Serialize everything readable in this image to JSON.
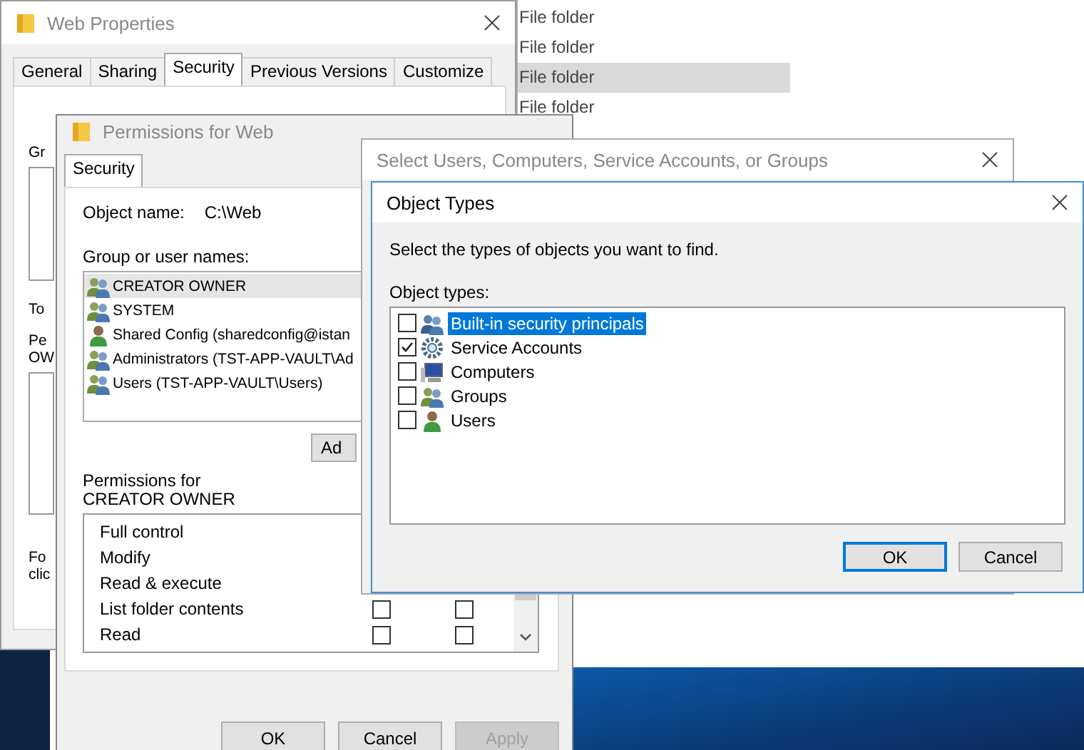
{
  "explorer": {
    "rows": [
      {
        "type": "File folder",
        "selected": false
      },
      {
        "type": "File folder",
        "selected": false
      },
      {
        "type": "File folder",
        "selected": true
      },
      {
        "type": "File folder",
        "selected": false
      }
    ]
  },
  "web_properties": {
    "title": "Web Properties",
    "tabs": [
      {
        "label": "General",
        "selected": false
      },
      {
        "label": "Sharing",
        "selected": false
      },
      {
        "label": "Security",
        "selected": true
      },
      {
        "label": "Previous Versions",
        "selected": false
      },
      {
        "label": "Customize",
        "selected": false
      }
    ],
    "visible_text": [
      "Gr",
      "To",
      "Pe",
      "OW",
      "Fo",
      "clic"
    ]
  },
  "permissions": {
    "title": "Permissions for Web",
    "tabs": [
      {
        "label": "Security",
        "selected": true
      }
    ],
    "object_name_label": "Object name:",
    "object_name": "C:\\Web",
    "group_label": "Group or user names:",
    "users": [
      {
        "name": "CREATOR OWNER",
        "kind": "group",
        "selected": true
      },
      {
        "name": "SYSTEM",
        "kind": "group",
        "selected": false
      },
      {
        "name": "Shared Config (sharedconfig@istan",
        "kind": "user",
        "selected": false
      },
      {
        "name": "Administrators (TST-APP-VAULT\\Ad",
        "kind": "group",
        "selected": false
      },
      {
        "name": "Users (TST-APP-VAULT\\Users)",
        "kind": "group",
        "selected": false
      }
    ],
    "add_button": "Ad",
    "permissions_label": "Permissions for CREATOR OWNER",
    "permissions": [
      {
        "name": "Full control"
      },
      {
        "name": "Modify"
      },
      {
        "name": "Read & execute"
      },
      {
        "name": "List folder contents",
        "allow": false,
        "deny": false
      },
      {
        "name": "Read",
        "allow": false,
        "deny": false
      }
    ],
    "buttons": [
      {
        "label": "OK",
        "disabled": false
      },
      {
        "label": "Cancel",
        "disabled": false
      },
      {
        "label": "Apply",
        "disabled": true
      }
    ]
  },
  "select_users": {
    "title": "Select Users, Computers, Service Accounts, or Groups"
  },
  "object_types": {
    "title": "Object Types",
    "prompt": "Select the types of objects you want to find.",
    "list_label": "Object types:",
    "items": [
      {
        "label": "Built-in security principals",
        "kind": "principals",
        "checked": false,
        "selected": true
      },
      {
        "label": "Service Accounts",
        "kind": "service",
        "checked": true,
        "selected": false
      },
      {
        "label": "Computers",
        "kind": "computer",
        "checked": false,
        "selected": false
      },
      {
        "label": "Groups",
        "kind": "group",
        "checked": false,
        "selected": false
      },
      {
        "label": "Users",
        "kind": "user",
        "checked": false,
        "selected": false
      }
    ],
    "buttons": [
      {
        "label": "OK",
        "default": true
      },
      {
        "label": "Cancel",
        "default": false
      }
    ]
  }
}
